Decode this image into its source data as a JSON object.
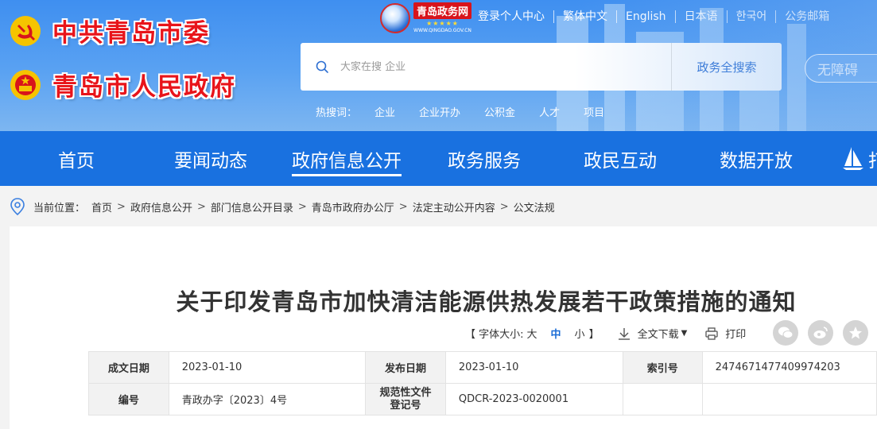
{
  "brand": {
    "party": "中共青岛市委",
    "government": "青岛市人民政府"
  },
  "site_logo": {
    "name": "青岛政务网",
    "stars": "★★★★★",
    "domain": "WWW.QINGDAO.GOV.CN"
  },
  "top_links": [
    "登录个人中心",
    "繁体中文",
    "English",
    "日本语",
    "한국어",
    "公务邮箱"
  ],
  "search": {
    "placeholder": "大家在搜 企业",
    "button": "政务全搜索"
  },
  "accessibility": "无障碍",
  "hot_search": {
    "label": "热搜词：",
    "keywords": [
      "企业",
      "企业开办",
      "公积金",
      "人才",
      "项目"
    ]
  },
  "nav": {
    "items": [
      "首页",
      "要闻动态",
      "政府信息公开",
      "政务服务",
      "政民互动",
      "数据开放",
      "打"
    ],
    "active": "政府信息公开"
  },
  "breadcrumb": {
    "label": "当前位置：",
    "items": [
      "首页",
      "政府信息公开",
      "部门信息公开目录",
      "青岛市政府办公厅",
      "法定主动公开内容",
      "公文法规"
    ]
  },
  "document": {
    "title": "关于印发青岛市加快清洁能源供热发展若干政策措施的通知",
    "font_size_label": "【 字体大小:",
    "sizes": [
      "大",
      "中",
      "小"
    ],
    "font_size_end": "】",
    "download": "全文下载",
    "print": "打印"
  },
  "meta_table": {
    "rows": [
      [
        "成文日期",
        "2023-01-10",
        "发布日期",
        "2023-01-10",
        "索引号",
        "2474671477409974203"
      ],
      [
        "编号",
        "青政办字〔2023〕4号",
        "规范性文件登记号",
        "QDCR-2023-0020001",
        "",
        ""
      ]
    ]
  },
  "colors": {
    "nav_bg": "#1971e0",
    "header_bg": "#4a95f0",
    "brand_red": "#e8141a",
    "link_blue": "#1a6cd6"
  }
}
